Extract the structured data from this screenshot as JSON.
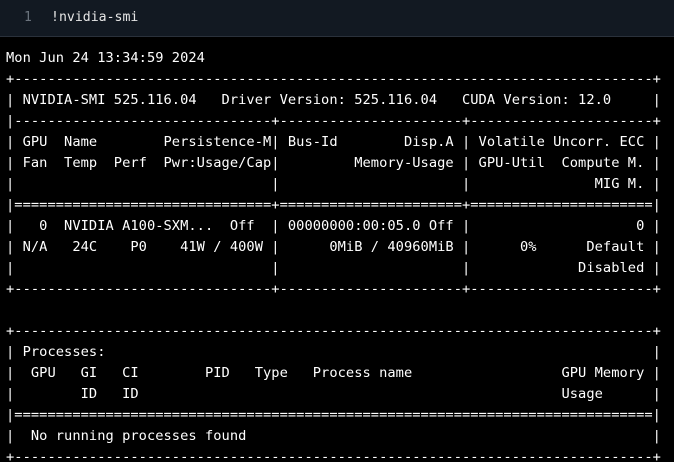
{
  "input_cell": {
    "line_number": "1",
    "code": "!nvidia-smi"
  },
  "output": {
    "lines": [
      "Mon Jun 24 13:34:59 2024",
      "+-----------------------------------------------------------------------------+",
      "| NVIDIA-SMI 525.116.04   Driver Version: 525.116.04   CUDA Version: 12.0     |",
      "|-------------------------------+----------------------+----------------------+",
      "| GPU  Name        Persistence-M| Bus-Id        Disp.A | Volatile Uncorr. ECC |",
      "| Fan  Temp  Perf  Pwr:Usage/Cap|         Memory-Usage | GPU-Util  Compute M. |",
      "|                               |                      |               MIG M. |",
      "|===============================+======================+======================|",
      "|   0  NVIDIA A100-SXM...  Off  | 00000000:00:05.0 Off |                    0 |",
      "| N/A   24C    P0    41W / 400W |      0MiB / 40960MiB |      0%      Default |",
      "|                               |                      |             Disabled |",
      "+-------------------------------+----------------------+----------------------+",
      "",
      "+-----------------------------------------------------------------------------+",
      "| Processes:                                                                  |",
      "|  GPU   GI   CI        PID   Type   Process name                  GPU Memory |",
      "|        ID   ID                                                   Usage      |",
      "|=============================================================================|",
      "|  No running processes found                                                 |",
      "+-----------------------------------------------------------------------------+"
    ]
  }
}
